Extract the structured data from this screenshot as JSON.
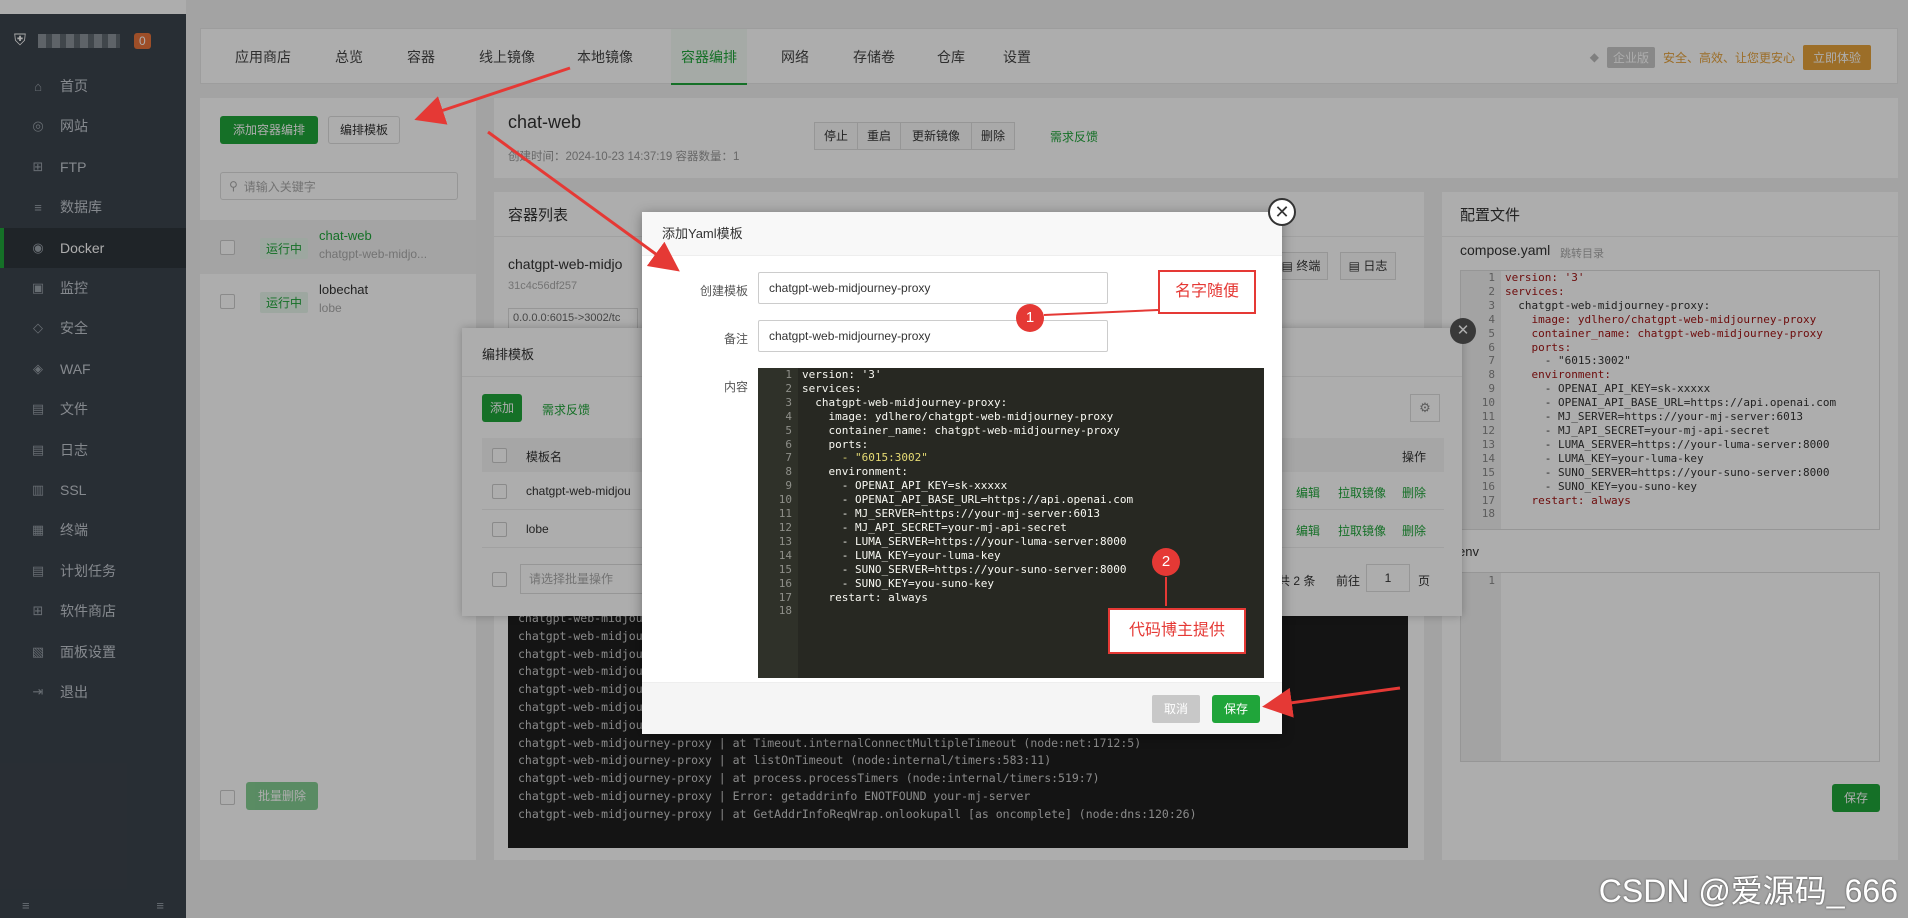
{
  "sidebar": {
    "badge": "0",
    "items": [
      {
        "label": "首页",
        "icon": "home-icon"
      },
      {
        "label": "网站",
        "icon": "globe-icon"
      },
      {
        "label": "FTP",
        "icon": "ftp-icon"
      },
      {
        "label": "数据库",
        "icon": "database-icon"
      },
      {
        "label": "Docker",
        "icon": "docker-icon"
      },
      {
        "label": "监控",
        "icon": "monitor-icon"
      },
      {
        "label": "安全",
        "icon": "shield-icon"
      },
      {
        "label": "WAF",
        "icon": "waf-icon"
      },
      {
        "label": "文件",
        "icon": "folder-icon"
      },
      {
        "label": "日志",
        "icon": "log-icon"
      },
      {
        "label": "SSL",
        "icon": "ssl-icon"
      },
      {
        "label": "终端",
        "icon": "terminal-icon"
      },
      {
        "label": "计划任务",
        "icon": "calendar-icon"
      },
      {
        "label": "软件商店",
        "icon": "store-icon"
      },
      {
        "label": "面板设置",
        "icon": "settings-icon"
      },
      {
        "label": "退出",
        "icon": "logout-icon"
      }
    ],
    "active_index": 4
  },
  "tabs": [
    "应用商店",
    "总览",
    "容器",
    "线上镜像",
    "本地镜像",
    "容器编排",
    "网络",
    "存储卷",
    "仓库",
    "设置"
  ],
  "active_tab": "容器编排",
  "enterprise": {
    "tag": "企业版",
    "slogan": "安全、高效、让您更安心",
    "button": "立即体验"
  },
  "left_panel": {
    "add_button": "添加容器编排",
    "template_button": "编排模板",
    "search_placeholder": "请输入关键字",
    "rows": [
      {
        "status": "运行中",
        "name": "chat-web",
        "sub": "chatgpt-web-midjo..."
      },
      {
        "status": "运行中",
        "name": "lobechat",
        "sub": "lobe"
      }
    ],
    "batch_button": "批量删除"
  },
  "header": {
    "title": "chat-web",
    "meta": "创建时间：2024-10-23 14:37:19  容器数量：1",
    "buttons": [
      "停止",
      "重启",
      "更新镜像",
      "删除"
    ],
    "feedback": "需求反馈"
  },
  "container_list": {
    "title": "容器列表",
    "name": "chatgpt-web-midjo",
    "id": "31c4c56df257",
    "ports": "0.0.0.0:6015->3002/tc",
    "btn_terminal": "终端",
    "btn_log": "日志",
    "logs": [
      "chatgpt-web-midjour",
      "chatgpt-web-midjour",
      "chatgpt-web-midjour",
      "chatgpt-web-midjour",
      "chatgpt-web-midjour",
      "chatgpt-web-midjour",
      "chatgpt-web-midjourney-proxy | at internalConnectMultiple (node:net:1108:5)",
      "chatgpt-web-midjourney-proxy | at Timeout.internalConnectMultipleTimeout (node:net:1712:5)",
      "chatgpt-web-midjourney-proxy | at listOnTimeout (node:internal/timers:583:11)",
      "chatgpt-web-midjourney-proxy | at process.processTimers (node:internal/timers:519:7)",
      "chatgpt-web-midjourney-proxy | Error: getaddrinfo ENOTFOUND your-mj-server",
      "chatgpt-web-midjourney-proxy | at GetAddrInfoReqWrap.onlookupall [as oncomplete] (node:dns:120:26)"
    ]
  },
  "config": {
    "title": "配置文件",
    "file": "compose.yaml",
    "jump": "跳转目录",
    "env_label": "env",
    "save": "保存",
    "lines": [
      "version: '3'",
      "services:",
      "  chatgpt-web-midjourney-proxy:",
      "    image: ydlhero/chatgpt-web-midjourney-proxy",
      "    container_name: chatgpt-web-midjourney-proxy",
      "    ports:",
      "      - \"6015:3002\"",
      "    environment:",
      "      - OPENAI_API_KEY=sk-xxxxx",
      "      - OPENAI_API_BASE_URL=https://api.openai.com",
      "      - MJ_SERVER=https://your-mj-server:6013",
      "      - MJ_API_SECRET=your-mj-api-secret",
      "      - LUMA_SERVER=https://your-luma-server:8000",
      "      - LUMA_KEY=your-luma-key",
      "      - SUNO_SERVER=https://your-suno-server:8000",
      "      - SUNO_KEY=you-suno-key",
      "    restart: always",
      ""
    ]
  },
  "template_dialog": {
    "title": "编排模板",
    "add": "添加",
    "feedback": "需求反馈",
    "col_name": "模板名",
    "col_action": "操作",
    "rows": [
      "chatgpt-web-midjou",
      "lobe"
    ],
    "actions": [
      "编辑",
      "拉取镜像",
      "删除"
    ],
    "batch_placeholder": "请选择批量操作",
    "total": "共 2 条",
    "goto": "前往",
    "page": "1",
    "page_suffix": "页"
  },
  "modal": {
    "title": "添加Yaml模板",
    "label_name": "创建模板",
    "value_name": "chatgpt-web-midjourney-proxy",
    "label_remark": "备注",
    "value_remark": "chatgpt-web-midjourney-proxy",
    "label_content": "内容",
    "lines": [
      "version: '3'",
      "services:",
      "  chatgpt-web-midjourney-proxy:",
      "    image: ydlhero/chatgpt-web-midjourney-proxy",
      "    container_name: chatgpt-web-midjourney-proxy",
      "    ports:",
      "      - \"6015:3002\"",
      "    environment:",
      "      - OPENAI_API_KEY=sk-xxxxx",
      "      - OPENAI_API_BASE_URL=https://api.openai.com",
      "      - MJ_SERVER=https://your-mj-server:6013",
      "      - MJ_API_SECRET=your-mj-api-secret",
      "      - LUMA_SERVER=https://your-luma-server:8000",
      "      - LUMA_KEY=your-luma-key",
      "      - SUNO_SERVER=https://your-suno-server:8000",
      "      - SUNO_KEY=you-suno-key",
      "    restart: always",
      ""
    ],
    "cancel": "取消",
    "save": "保存"
  },
  "annotations": {
    "note1": "名字随便",
    "num1": "1",
    "note2": "代码博主提供",
    "num2": "2"
  },
  "watermark": "CSDN @爱源码_666",
  "colors": {
    "green": "#20a53a",
    "red": "#e53935",
    "sidebar": "#3c444d"
  }
}
